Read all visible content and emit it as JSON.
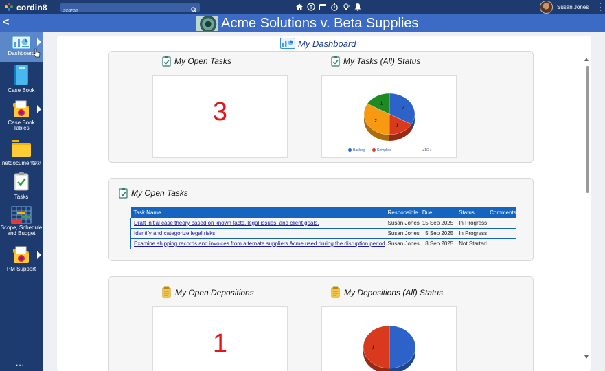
{
  "app": {
    "name": "cordin8"
  },
  "search": {
    "placeholder": "search"
  },
  "user": {
    "name": "Susan Jones"
  },
  "case": {
    "title": "Acme Solutions v. Beta Supplies"
  },
  "sidebar": {
    "items": [
      {
        "label": "Dashboard"
      },
      {
        "label": "Case Book"
      },
      {
        "label": "Case Book Tables"
      },
      {
        "label": "netdocuments®"
      },
      {
        "label": "Tasks"
      },
      {
        "label": "Scope, Schedule and Budget"
      },
      {
        "label": "PM Support"
      }
    ],
    "more": "..."
  },
  "dashboard": {
    "title": "My Dashboard",
    "open_tasks_title": "My Open Tasks",
    "open_tasks_count": "3",
    "tasks_status_title": "My Tasks (All) Status",
    "tasks_legend": {
      "backlog": "Backlog",
      "complete": "Complete",
      "page": "1/2"
    },
    "task_list_title": "My Open Tasks",
    "open_depositions_title": "My Open Depositions",
    "open_depositions_count": "1",
    "depositions_status_title": "My Depositions (All) Status"
  },
  "task_table": {
    "headers": {
      "name": "Task Name",
      "responsible": "Responsible",
      "due": "Due",
      "status": "Status",
      "comments": "Comments"
    },
    "rows": [
      {
        "name": "Draft initial case theory based on known facts, legal issues, and client goals.",
        "responsible": "Susan Jones",
        "due": "15 Sep 2025",
        "status": "In Progress",
        "comments": ""
      },
      {
        "name": "Identify and categorize legal risks",
        "responsible": "Susan Jones",
        "due": "5 Sep 2025",
        "status": "In Progress",
        "comments": ""
      },
      {
        "name": "Examine shipping records and invoices from alternate suppliers Acme used during the disruption period",
        "responsible": "Susan Jones",
        "due": "8 Sep 2025",
        "status": "Not Started",
        "comments": ""
      }
    ]
  },
  "chart_data": [
    {
      "type": "pie",
      "title": "My Tasks (All) Status",
      "slices": [
        {
          "value": 2,
          "color": "#2d63c8"
        },
        {
          "value": 1,
          "color": "#d93a1e"
        },
        {
          "value": 2,
          "color": "#f79a12"
        },
        {
          "value": 1,
          "color": "#1e8a22"
        }
      ],
      "legend": [
        "Backlog",
        "Complete"
      ],
      "legend_page": "1/2"
    },
    {
      "type": "pie",
      "title": "My Depositions (All) Status",
      "slices": [
        {
          "value": 1,
          "color": "#2d63c8"
        },
        {
          "value": 1,
          "color": "#d93a1e"
        }
      ],
      "visible_labels": [
        "1"
      ]
    }
  ],
  "colors": {
    "topbar": "#1d3b6e",
    "titlebar": "#3b6bc4",
    "accent_red": "#e5141a",
    "table_header": "#1565c0"
  }
}
